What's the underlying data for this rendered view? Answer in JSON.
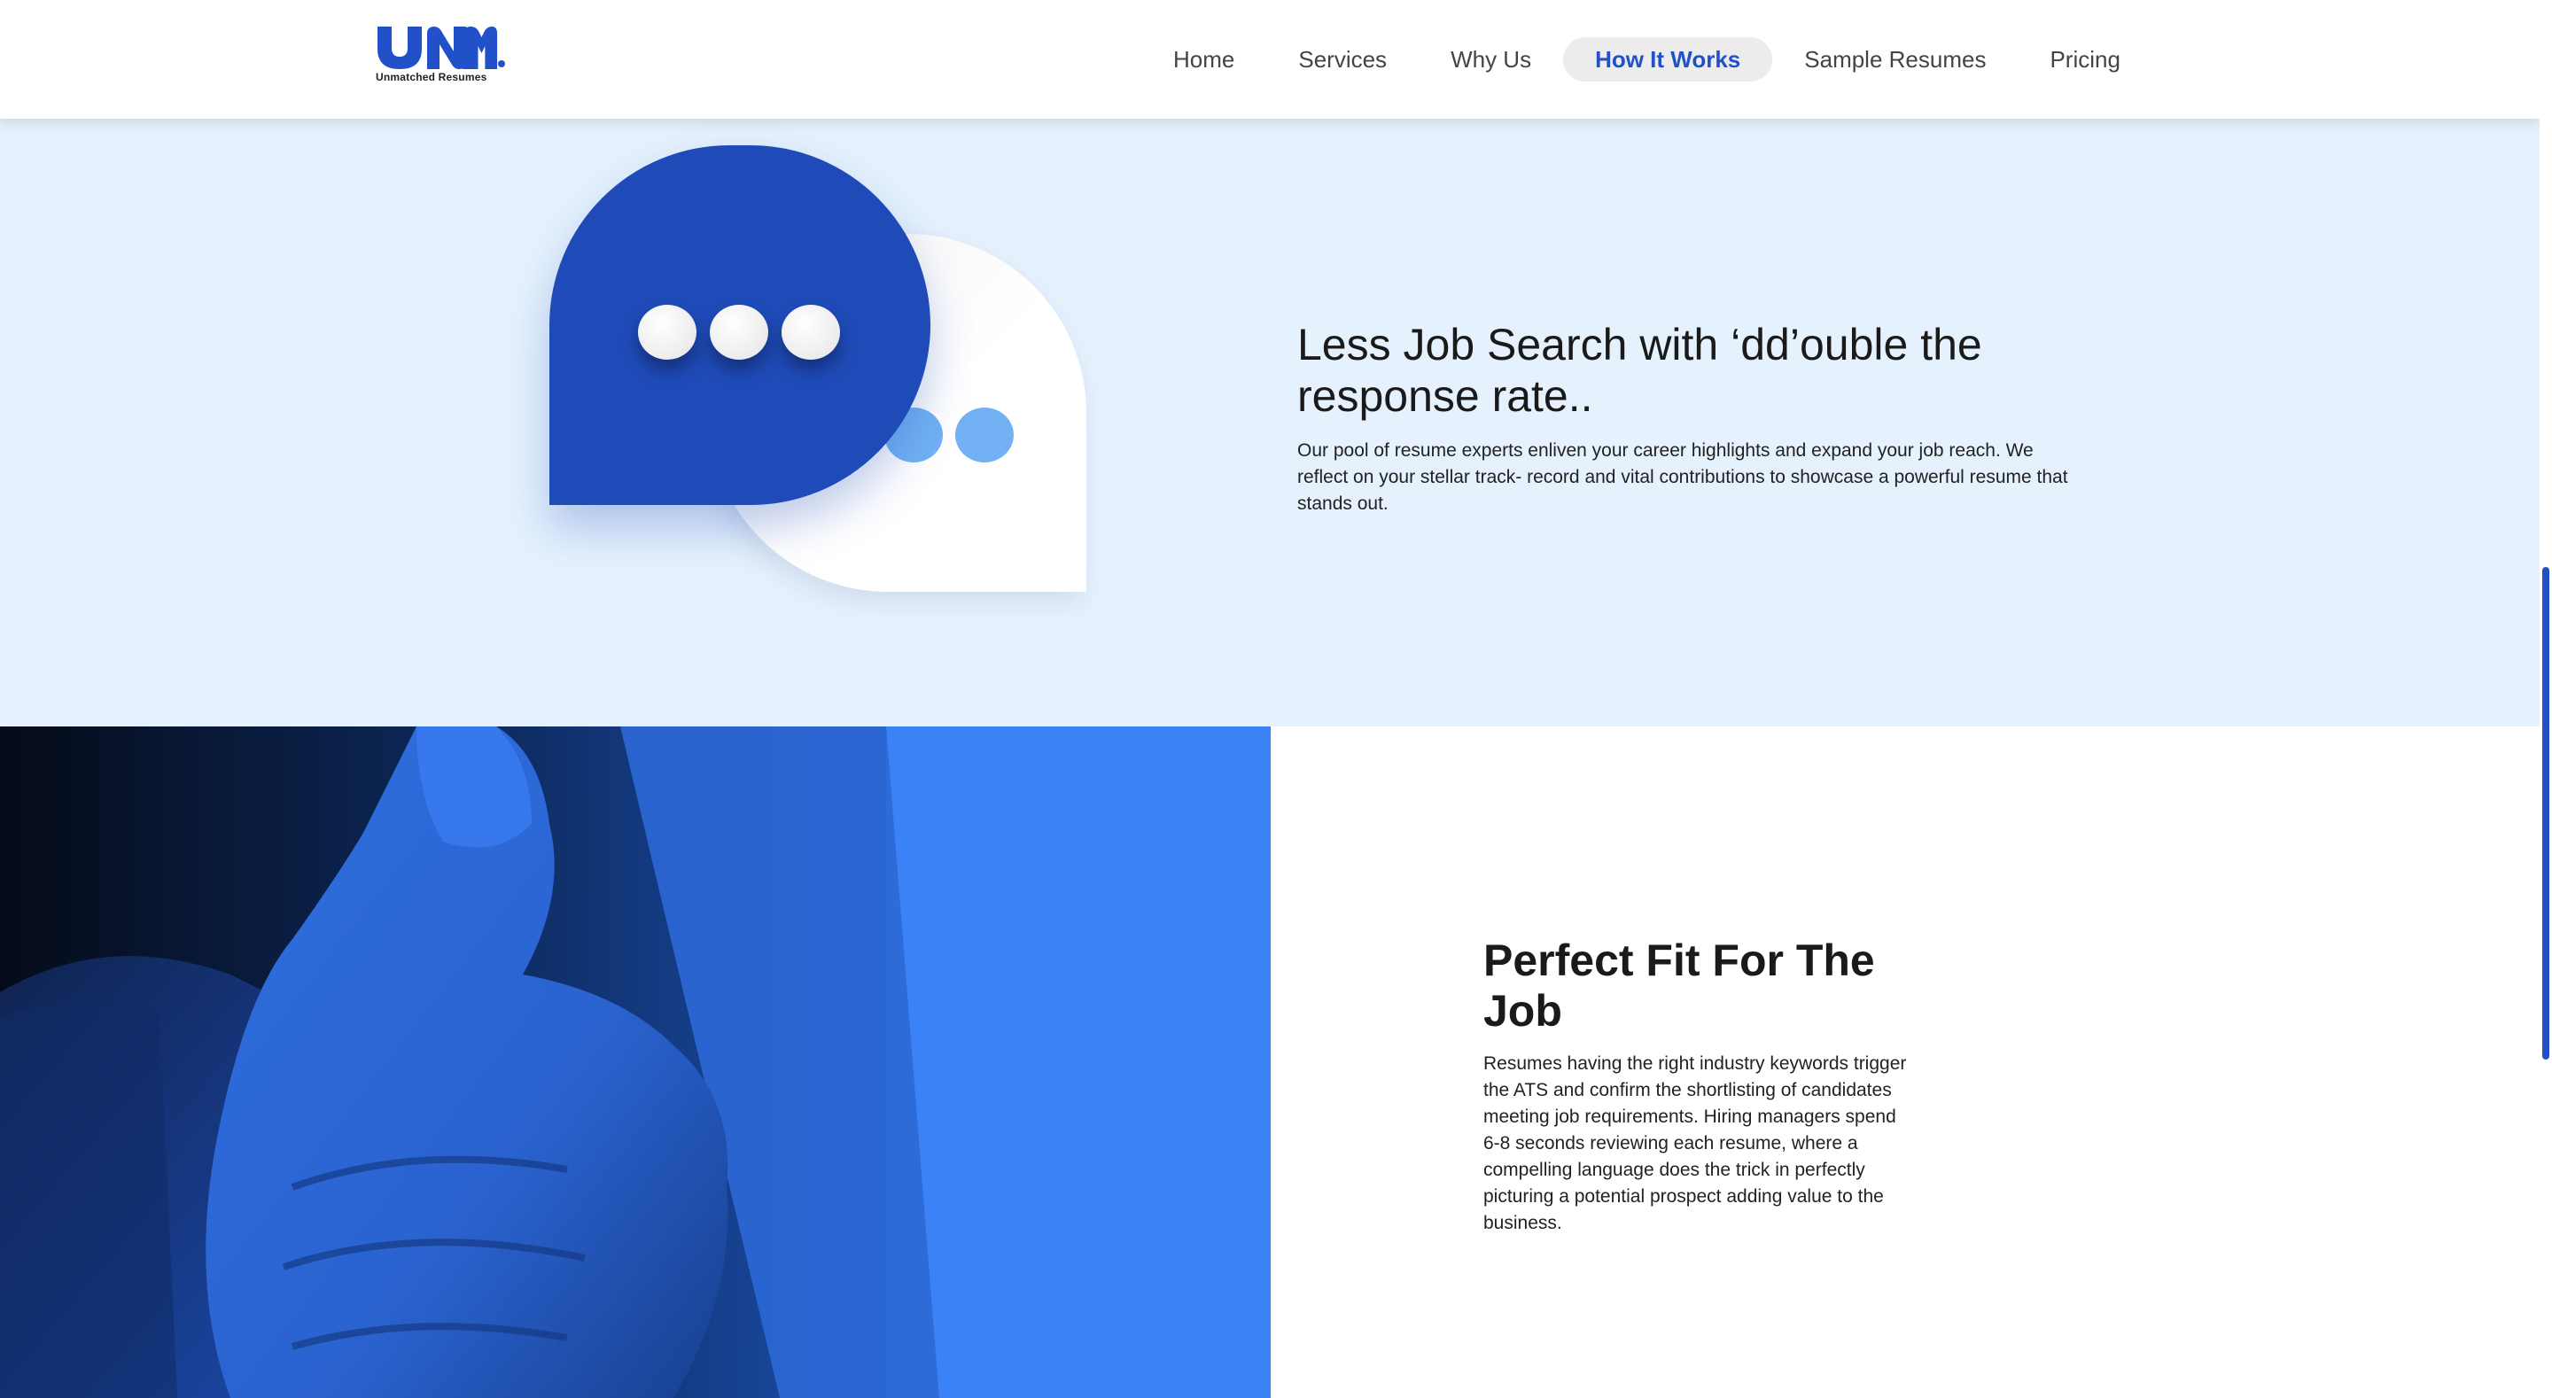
{
  "header": {
    "logo_text": "UNM",
    "logo_caption": "Unmatched Resumes",
    "nav": [
      {
        "label": "Home",
        "active": false
      },
      {
        "label": "Services",
        "active": false
      },
      {
        "label": "Why Us",
        "active": false
      },
      {
        "label": "How It Works",
        "active": true
      },
      {
        "label": "Sample Resumes",
        "active": false
      },
      {
        "label": "Pricing",
        "active": false
      }
    ]
  },
  "section1": {
    "title": "Less Job Search with ‘dd’ouble the response rate..",
    "body": "Our pool of resume experts enliven your career highlights and expand your job reach. We reflect on your stellar track- record and vital contributions to showcase a powerful resume that stands out.",
    "illustration_icon": "chat-bubbles-icon"
  },
  "section2": {
    "title": "Perfect Fit For The Job",
    "body": "Resumes having the right industry keywords trigger the ATS and confirm the shortlisting of candidates meeting job requirements. Hiring managers spend 6-8 seconds reviewing each resume, where a compelling language does the trick in perfectly picturing a potential prospect adding value to the business.",
    "photo_icon": "thumbs-up-photo"
  },
  "colors": {
    "brand_blue": "#2150c8",
    "bubble_blue": "#1f4bb8",
    "section1_bg": "#e5f1fd",
    "photo_blue": "#3b82f6",
    "light_dot": "#72b2f4"
  }
}
